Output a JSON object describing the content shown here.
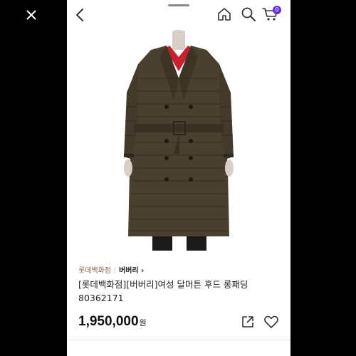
{
  "icons": {
    "close": "close-icon",
    "back": "chevron-left-icon",
    "home": "home-icon",
    "search": "search-icon",
    "cart": "cart-icon",
    "share": "share-icon",
    "wishlist": "heart-icon"
  },
  "header": {
    "cart_count": "0"
  },
  "product": {
    "store": "롯데백화점",
    "brand": "버버리 ›",
    "title": "[롯데백화점][버버리]여성 달머튼 후드 롱패딩 80362171",
    "price": "1,950,000",
    "currency": "원"
  },
  "colors": {
    "accent": "#6b2fd6",
    "store_text": "#8a6a4e",
    "coat": "#4a4030"
  }
}
